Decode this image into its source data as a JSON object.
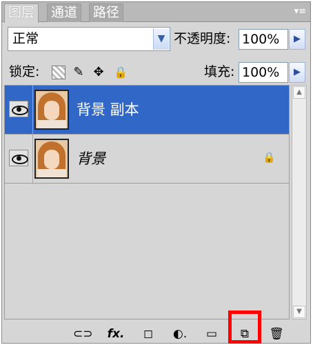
{
  "tabs": [
    {
      "label": "图层",
      "active": true
    },
    {
      "label": "通道",
      "active": false
    },
    {
      "label": "路径",
      "active": false
    }
  ],
  "tab_menu_icon": "panel-menu-icon",
  "blend_mode": {
    "value": "正常"
  },
  "opacity": {
    "label": "不透明度:",
    "value": "100%"
  },
  "lock": {
    "label": "锁定:",
    "icons": [
      "lock-transparency-icon",
      "lock-paint-icon",
      "lock-position-icon",
      "lock-all-icon"
    ]
  },
  "fill": {
    "label": "填充:",
    "value": "100%"
  },
  "layers": [
    {
      "name": "背景 副本",
      "selected": true,
      "visible": true,
      "locked": false
    },
    {
      "name": "背景",
      "selected": false,
      "visible": true,
      "locked": true
    }
  ],
  "bottom_tools": [
    {
      "name": "link-layers-icon",
      "glyph": "⊂⊃"
    },
    {
      "name": "layer-style-icon",
      "glyph": "fx."
    },
    {
      "name": "add-mask-icon",
      "glyph": "◻"
    },
    {
      "name": "adjustment-layer-icon",
      "glyph": "◐."
    },
    {
      "name": "new-group-icon",
      "glyph": "▭"
    },
    {
      "name": "new-layer-icon",
      "glyph": "⧉"
    },
    {
      "name": "delete-layer-icon",
      "glyph": "🗑"
    }
  ],
  "colors": {
    "selection": "#3167c6",
    "panel": "#d6d6d6",
    "highlight": "#ff0000"
  }
}
